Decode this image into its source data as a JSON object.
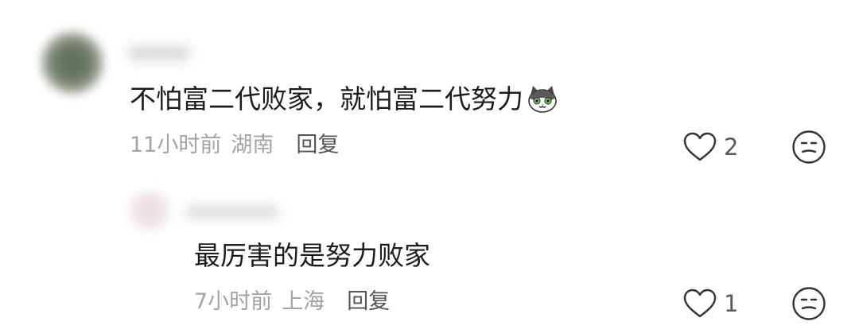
{
  "comments": [
    {
      "text": "不怕富二代败家，就怕富二代努力",
      "emoji": "cat-face-icon",
      "time": "11小时前",
      "location": "湖南",
      "reply_label": "回复",
      "likes": "2"
    },
    {
      "text": "最厉害的是努力败家",
      "time": "7小时前",
      "location": "上海",
      "reply_label": "回复",
      "likes": "1"
    }
  ],
  "icons": {
    "like": "heart-icon",
    "dislike": "unamused-face-icon"
  },
  "colors": {
    "text": "#1c1c1c",
    "meta": "#a3a3a3",
    "reply": "#555555",
    "icon": "#333333"
  }
}
